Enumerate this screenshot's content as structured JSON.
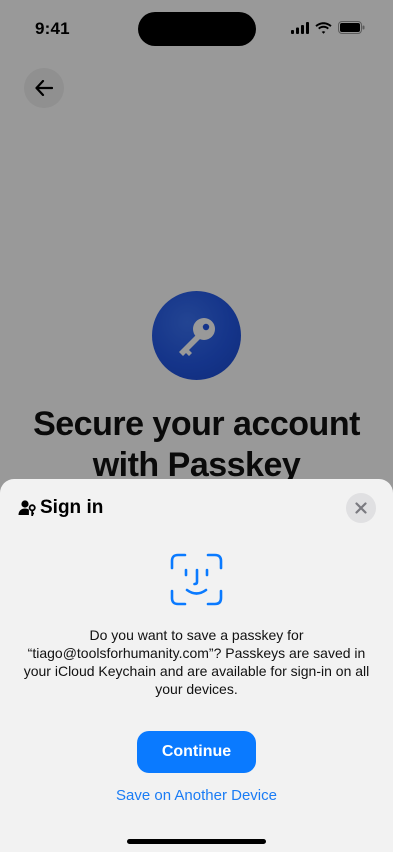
{
  "status_bar": {
    "time": "9:41"
  },
  "background_page": {
    "title": "Secure your account with Passkey"
  },
  "sheet": {
    "title": "Sign in",
    "message": "Do you want to save a passkey for “tiago@toolsforhumanity.com”? Passkeys are saved in your iCloud Keychain and are available for sign-in on all your devices.",
    "continue_label": "Continue",
    "other_device_label": "Save on Another Device"
  },
  "colors": {
    "accent": "#0a7aff",
    "key_circle": "#2358e6"
  },
  "icons": [
    "back-arrow-icon",
    "key-icon",
    "person-key-icon",
    "close-icon",
    "face-id-icon",
    "signal-icon",
    "wifi-icon",
    "battery-icon"
  ]
}
